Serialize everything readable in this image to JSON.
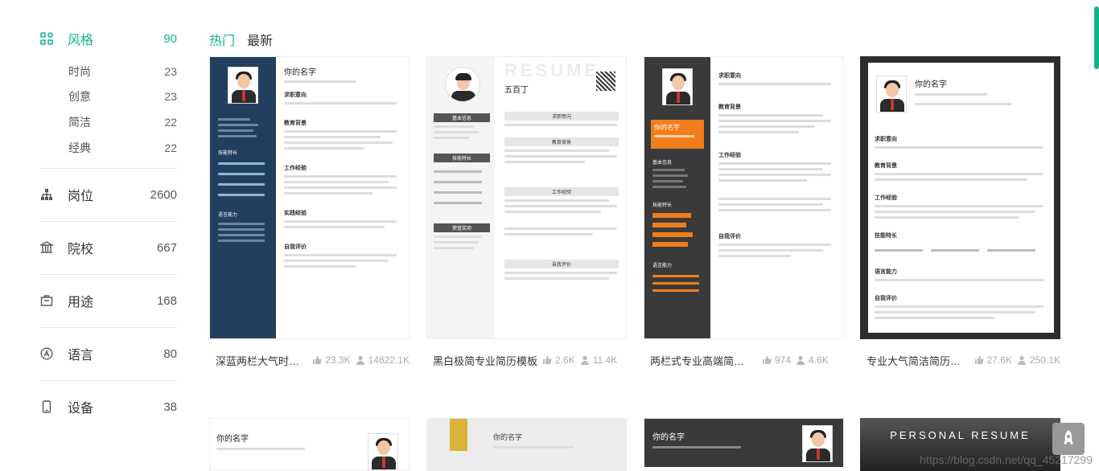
{
  "sidebar": {
    "style": {
      "label": "风格",
      "count": "90",
      "icon": "grid-icon"
    },
    "style_subs": [
      {
        "label": "时尚",
        "count": "23"
      },
      {
        "label": "创意",
        "count": "23"
      },
      {
        "label": "简洁",
        "count": "22"
      },
      {
        "label": "经典",
        "count": "22"
      }
    ],
    "categories": [
      {
        "label": "岗位",
        "count": "2600",
        "icon": "org-chart-icon"
      },
      {
        "label": "院校",
        "count": "667",
        "icon": "school-icon"
      },
      {
        "label": "用途",
        "count": "168",
        "icon": "briefcase-icon"
      },
      {
        "label": "语言",
        "count": "80",
        "icon": "language-a-icon"
      },
      {
        "label": "设备",
        "count": "38",
        "icon": "phone-icon"
      }
    ]
  },
  "tabs": [
    {
      "label": "热门",
      "active": true
    },
    {
      "label": "最新",
      "active": false
    }
  ],
  "cards": [
    {
      "title": "深蓝两栏大气时尚简...",
      "likes": "23.3K",
      "users": "14822.1K"
    },
    {
      "title": "黑白极简专业简历模板",
      "likes": "2.6K",
      "users": "11.4K"
    },
    {
      "title": "两栏式专业高端简历...",
      "likes": "974",
      "users": "4.6K"
    },
    {
      "title": "专业大气简洁简历模板",
      "likes": "27.6K",
      "users": "250.1K"
    }
  ],
  "preview_text": {
    "name": "你的名字",
    "name_alt": "五百丁",
    "resume_word": "RESUME",
    "personal_resume": "PERSONAL RESUME",
    "sections": {
      "job": "求职意向",
      "edu": "教育背景",
      "work": "工作经验",
      "skills": "技能特长",
      "lang": "语言能力",
      "self": "自我评价",
      "awards": "荣誉奖项",
      "practice": "实践经验",
      "basic": "基本信息"
    }
  },
  "colors": {
    "accent": "#11b38e",
    "navy": "#22405e",
    "orange": "#f27d1c",
    "dark": "#3a3a3a"
  },
  "watermark": "https://blog.csdn.net/qq_45217299"
}
